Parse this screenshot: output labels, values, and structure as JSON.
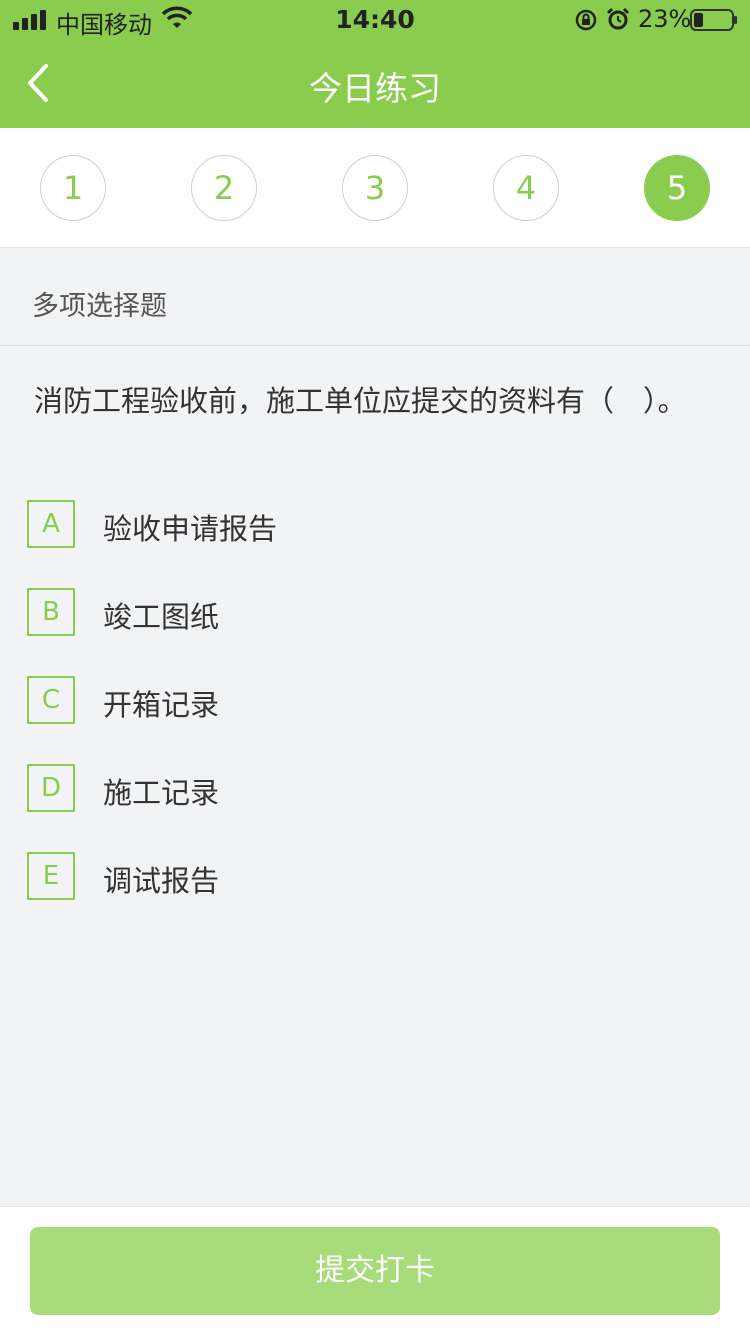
{
  "status_bar": {
    "carrier": "中国移动",
    "time": "14:40",
    "battery": "23%"
  },
  "nav": {
    "title": "今日练习",
    "back_icon": "chevron-left-icon"
  },
  "steps": {
    "items": [
      "1",
      "2",
      "3",
      "4",
      "5"
    ],
    "active": "5"
  },
  "question": {
    "type": "多项选择题",
    "text": "消防工程验收前，施工单位应提交的资料有（　）。",
    "options": [
      {
        "key": "A",
        "text": "验收申请报告"
      },
      {
        "key": "B",
        "text": "竣工图纸"
      },
      {
        "key": "C",
        "text": "开箱记录"
      },
      {
        "key": "D",
        "text": "施工记录"
      },
      {
        "key": "E",
        "text": "调试报告"
      }
    ]
  },
  "footer": {
    "submit_label": "提交打卡"
  },
  "colors": {
    "accent": "#8acd4e",
    "submit_disabled": "#a8dc7a",
    "background": "#f2f3f5"
  }
}
